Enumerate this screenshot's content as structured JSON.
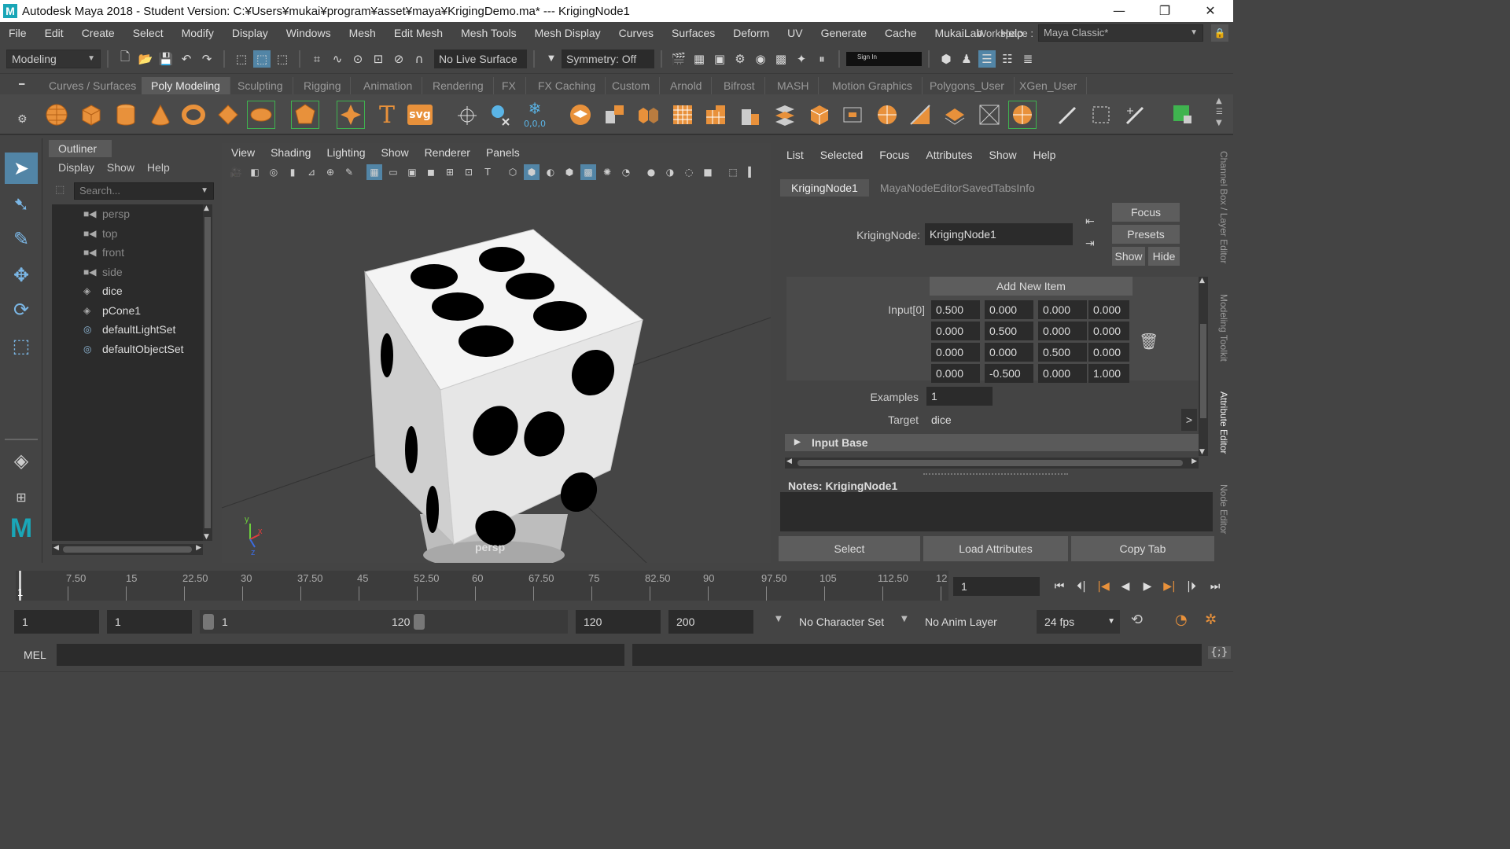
{
  "window": {
    "title": "Autodesk Maya 2018 - Student Version: C:¥Users¥mukai¥program¥asset¥maya¥KrigingDemo.ma*   ---   KrigingNode1",
    "logo": "M",
    "minimize": "—",
    "restore": "❐",
    "close": "✕"
  },
  "menubar": [
    "File",
    "Edit",
    "Create",
    "Select",
    "Modify",
    "Display",
    "Windows",
    "Mesh",
    "Edit Mesh",
    "Mesh Tools",
    "Mesh Display",
    "Curves",
    "Surfaces",
    "Deform",
    "UV",
    "Generate",
    "Cache",
    "MukaiLab",
    "Help"
  ],
  "workspace": {
    "label": "Workspace :",
    "value": "Maya Classic*"
  },
  "statusline": {
    "mode": "Modeling",
    "live_surface": "No Live Surface",
    "symmetry": "Symmetry: Off",
    "sign_in": "Sign In"
  },
  "shelf_tabs": [
    "Curves / Surfaces",
    "Poly Modeling",
    "Sculpting",
    "Rigging",
    "Animation",
    "Rendering",
    "FX",
    "FX Caching",
    "Custom",
    "Arnold",
    "Bifrost",
    "MASH",
    "Motion Graphics",
    "Polygons_User",
    "XGen_User"
  ],
  "shelf_active_tab": "Poly Modeling",
  "shelf_text_icons": {
    "type": "T",
    "svg": "svg",
    "coords": "0,0,0"
  },
  "outliner": {
    "title": "Outliner",
    "menu": [
      "Display",
      "Show",
      "Help"
    ],
    "search_placeholder": "Search...",
    "items": [
      {
        "label": "persp",
        "icon": "camera-icon",
        "dim": true
      },
      {
        "label": "top",
        "icon": "camera-icon",
        "dim": true
      },
      {
        "label": "front",
        "icon": "camera-icon",
        "dim": true
      },
      {
        "label": "side",
        "icon": "camera-icon",
        "dim": true
      },
      {
        "label": "dice",
        "icon": "mesh-icon",
        "dim": false
      },
      {
        "label": "pCone1",
        "icon": "mesh-icon",
        "dim": false
      },
      {
        "label": "defaultLightSet",
        "icon": "set-icon",
        "dim": false
      },
      {
        "label": "defaultObjectSet",
        "icon": "set-icon",
        "dim": false
      }
    ]
  },
  "viewport": {
    "menu": [
      "View",
      "Shading",
      "Lighting",
      "Show",
      "Renderer",
      "Panels"
    ],
    "camera": "persp",
    "axis_x": "x",
    "axis_y": "y",
    "axis_z": "z"
  },
  "attribute_editor": {
    "menu": [
      "List",
      "Selected",
      "Focus",
      "Attributes",
      "Show",
      "Help"
    ],
    "tabs": [
      "KrigingNode1",
      "MayaNodeEditorSavedTabsInfo"
    ],
    "node_label": "KrigingNode:",
    "node_value": "KrigingNode1",
    "buttons": {
      "focus": "Focus",
      "presets": "Presets",
      "show": "Show",
      "hide": "Hide"
    },
    "add_new_item": "Add New Item",
    "input_label": "Input[0]",
    "matrix": [
      [
        "0.500",
        "0.000",
        "0.000",
        "0.000"
      ],
      [
        "0.000",
        "0.500",
        "0.000",
        "0.000"
      ],
      [
        "0.000",
        "0.000",
        "0.500",
        "0.000"
      ],
      [
        "0.000",
        "-0.500",
        "0.000",
        "1.000"
      ]
    ],
    "examples_label": "Examples",
    "examples_value": "1",
    "target_label": "Target",
    "target_value": "dice",
    "target_btn": ">",
    "section": "Input Base",
    "notes_label": "Notes:  KrigingNode1",
    "bottom_buttons": {
      "select": "Select",
      "load": "Load Attributes",
      "copy": "Copy Tab"
    }
  },
  "side_tabs": [
    "Channel Box / Layer Editor",
    "Modeling Toolkit",
    "Attribute Editor",
    "Node Editor"
  ],
  "side_tab_active": "Attribute Editor",
  "timeslider": {
    "ticks": [
      "1",
      "7.50",
      "15",
      "22.50",
      "30",
      "37.50",
      "45",
      "52.50",
      "60",
      "67.50",
      "75",
      "82.50",
      "90",
      "97.50",
      "105",
      "112.50",
      "12"
    ],
    "current_frame": "1"
  },
  "range": {
    "start": "1",
    "inner_start": "1",
    "slider_start": "1",
    "slider_end": "120",
    "end": "120",
    "outer_end": "200",
    "character_set": "No Character Set",
    "anim_layer": "No Anim Layer",
    "fps": "24 fps"
  },
  "cmdline": {
    "label": "MEL"
  }
}
